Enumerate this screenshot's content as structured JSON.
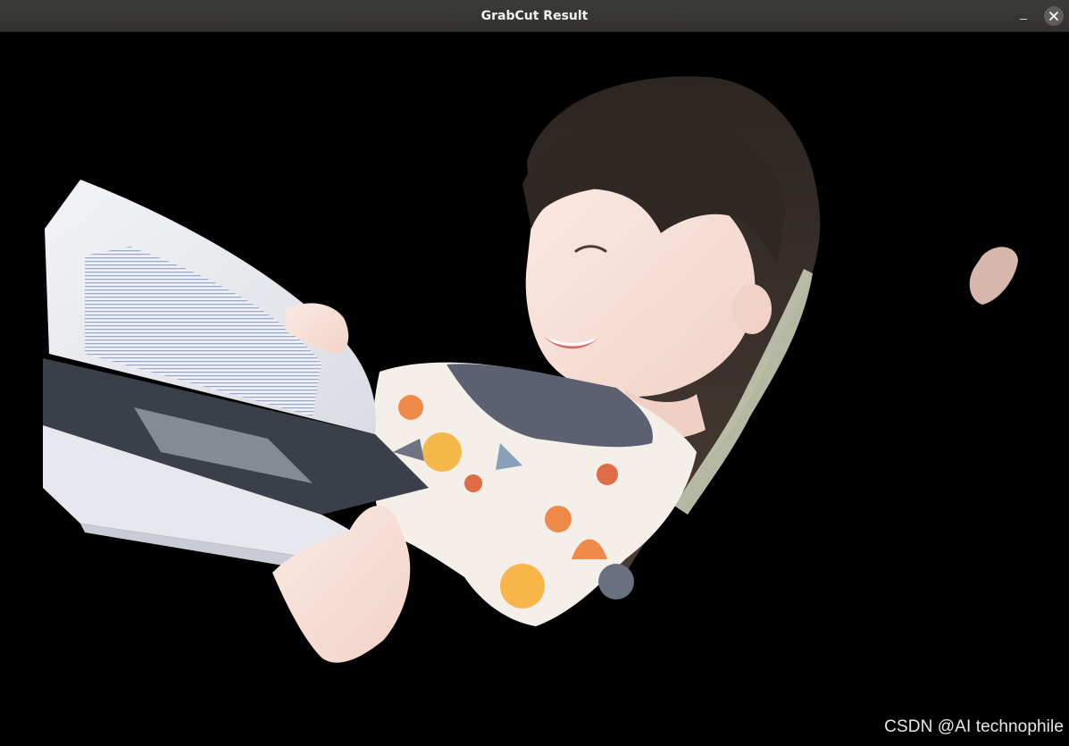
{
  "window": {
    "title": "GrabCut Result",
    "minimize_icon": "minimize-icon",
    "close_icon": "close-icon"
  },
  "image": {
    "subject": "grabcut-foreground",
    "background_color": "#000000"
  },
  "watermark": {
    "text": "CSDN @AI technophile"
  }
}
